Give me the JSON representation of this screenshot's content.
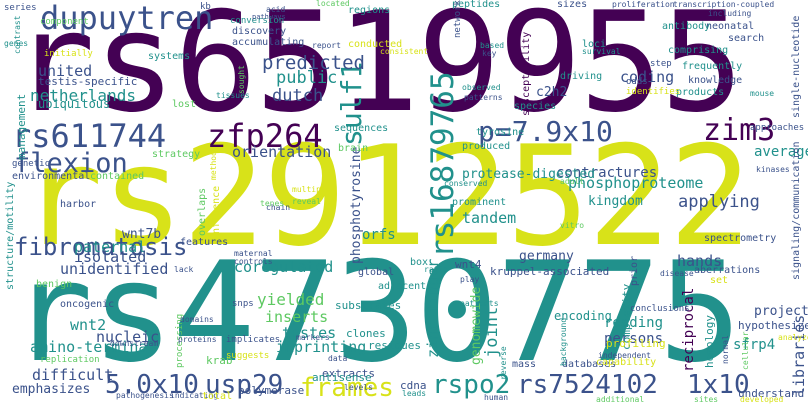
{
  "colors": {
    "background": "#ffffff",
    "purple": "#440154",
    "indigo": "#3b528b",
    "teal": "#21918c",
    "green": "#5ec962",
    "yellow": "#d8e219"
  },
  "words": [
    {
      "text": "rs6519955",
      "color": "purple"
    },
    {
      "text": "rs2912522",
      "color": "yellow"
    },
    {
      "text": "rs4730775",
      "color": "teal"
    },
    {
      "text": "dupuytren",
      "color": "indigo"
    },
    {
      "text": "rs611744",
      "color": "indigo"
    },
    {
      "text": "zfp264",
      "color": "purple"
    },
    {
      "text": "flexion",
      "color": "indigo"
    },
    {
      "text": "sulf1",
      "color": "teal"
    },
    {
      "text": "rs16879765",
      "color": "teal"
    },
    {
      "text": "p=7.9x10",
      "color": "indigo"
    },
    {
      "text": "zim3",
      "color": "purple"
    },
    {
      "text": "fibromatosis",
      "color": "indigo"
    },
    {
      "text": "5.0x10",
      "color": "indigo"
    },
    {
      "text": "usp29",
      "color": "indigo"
    },
    {
      "text": "frames",
      "color": "yellow"
    },
    {
      "text": "rspo2",
      "color": "teal"
    },
    {
      "text": "rs7524102",
      "color": "indigo"
    },
    {
      "text": "1x10",
      "color": "indigo"
    },
    {
      "text": "predicted",
      "color": "indigo"
    },
    {
      "text": "public",
      "color": "teal"
    },
    {
      "text": "dutch",
      "color": "indigo"
    },
    {
      "text": "netherlands",
      "color": "teal"
    },
    {
      "text": "united",
      "color": "indigo"
    },
    {
      "text": "testis-specific",
      "color": "indigo"
    },
    {
      "text": "ubiquitous",
      "color": "teal"
    },
    {
      "text": "orientation",
      "color": "indigo"
    },
    {
      "text": "contractures",
      "color": "indigo"
    },
    {
      "text": "protease-digested",
      "color": "teal"
    },
    {
      "text": "coding",
      "color": "indigo"
    },
    {
      "text": "c2h2",
      "color": "indigo"
    },
    {
      "text": "average",
      "color": "teal"
    },
    {
      "text": "phosphoproteome",
      "color": "teal"
    },
    {
      "text": "kingdom",
      "color": "teal"
    },
    {
      "text": "applying",
      "color": "indigo"
    },
    {
      "text": "tandem",
      "color": "teal"
    },
    {
      "text": "germany",
      "color": "indigo"
    },
    {
      "text": "kruppel-associated",
      "color": "indigo"
    },
    {
      "text": "hands",
      "color": "indigo"
    },
    {
      "text": "paternal",
      "color": "teal"
    },
    {
      "text": "isolated",
      "color": "indigo"
    },
    {
      "text": "unidentified",
      "color": "indigo"
    },
    {
      "text": "coregulated",
      "color": "teal"
    },
    {
      "text": "wnt7b",
      "color": "indigo"
    },
    {
      "text": "orfs",
      "color": "teal"
    },
    {
      "text": "wnt4",
      "color": "indigo"
    },
    {
      "text": "phosphotyrosine",
      "color": "indigo"
    },
    {
      "text": "yielded",
      "color": "green"
    },
    {
      "text": "inserts",
      "color": "green"
    },
    {
      "text": "testes",
      "color": "teal"
    },
    {
      "text": "imprinting",
      "color": "teal"
    },
    {
      "text": "zinc-finger",
      "color": "teal"
    },
    {
      "text": "genomewide",
      "color": "green"
    },
    {
      "text": "joint",
      "color": "teal"
    },
    {
      "text": "reading",
      "color": "teal"
    },
    {
      "text": "persons",
      "color": "indigo"
    },
    {
      "text": "project",
      "color": "indigo"
    },
    {
      "text": "hypothesized",
      "color": "indigo"
    },
    {
      "text": "sfrp4",
      "color": "teal"
    },
    {
      "text": "libraries",
      "color": "indigo"
    },
    {
      "text": "wnt2",
      "color": "teal"
    },
    {
      "text": "nucleic",
      "color": "indigo"
    },
    {
      "text": "amino-terminal",
      "color": "teal"
    },
    {
      "text": "difficult",
      "color": "indigo"
    },
    {
      "text": "emphasizes",
      "color": "indigo"
    },
    {
      "text": "understand",
      "color": "indigo"
    },
    {
      "text": "krab",
      "color": "green"
    },
    {
      "text": "extracts",
      "color": "indigo"
    },
    {
      "text": "clones",
      "color": "teal"
    },
    {
      "text": "residues",
      "color": "teal"
    },
    {
      "text": "cdna",
      "color": "indigo"
    },
    {
      "text": "reciprocal",
      "color": "purple"
    },
    {
      "text": "homology",
      "color": "teal"
    },
    {
      "text": "complexity",
      "color": "teal"
    },
    {
      "text": "profiling",
      "color": "yellow"
    },
    {
      "text": "encoding",
      "color": "teal"
    },
    {
      "text": "substrates",
      "color": "teal"
    },
    {
      "text": "antisense",
      "color": "teal"
    },
    {
      "text": "polymerase",
      "color": "indigo"
    },
    {
      "text": "management",
      "color": "teal"
    },
    {
      "text": "initially",
      "color": "yellow"
    },
    {
      "text": "component",
      "color": "green"
    },
    {
      "text": "series",
      "color": "indigo"
    },
    {
      "text": "contrast",
      "color": "teal"
    },
    {
      "text": "conversion",
      "color": "teal"
    },
    {
      "text": "systems",
      "color": "teal"
    },
    {
      "text": "accumulating",
      "color": "indigo"
    },
    {
      "text": "discovery",
      "color": "indigo"
    },
    {
      "text": "regions",
      "color": "teal"
    },
    {
      "text": "peptides",
      "color": "teal"
    },
    {
      "text": "sizes",
      "color": "indigo"
    },
    {
      "text": "proliferation",
      "color": "indigo"
    },
    {
      "text": "transcription-coupled",
      "color": "indigo"
    },
    {
      "text": "neonatal",
      "color": "indigo"
    },
    {
      "text": "antibody",
      "color": "teal"
    },
    {
      "text": "search",
      "color": "indigo"
    },
    {
      "text": "comprising",
      "color": "teal"
    },
    {
      "text": "frequently",
      "color": "teal"
    },
    {
      "text": "knowledge",
      "color": "indigo"
    },
    {
      "text": "products",
      "color": "teal"
    },
    {
      "text": "single-nucleotide",
      "color": "indigo"
    },
    {
      "text": "approaches",
      "color": "indigo"
    },
    {
      "text": "step",
      "color": "indigo"
    },
    {
      "text": "identifies",
      "color": "yellow"
    },
    {
      "text": "odds",
      "color": "indigo"
    },
    {
      "text": "driving",
      "color": "teal"
    },
    {
      "text": "susceptibility",
      "color": "purple"
    },
    {
      "text": "loci",
      "color": "teal"
    },
    {
      "text": "survival",
      "color": "teal"
    },
    {
      "text": "networks",
      "color": "indigo"
    },
    {
      "text": "conducted",
      "color": "yellow"
    },
    {
      "text": "report",
      "color": "indigo"
    },
    {
      "text": "kb",
      "color": "indigo"
    },
    {
      "text": "acid",
      "color": "indigo"
    },
    {
      "text": "pathways",
      "color": "indigo"
    },
    {
      "text": "including",
      "color": "indigo"
    },
    {
      "text": "lost",
      "color": "green"
    },
    {
      "text": "strategy",
      "color": "green"
    },
    {
      "text": "brain",
      "color": "green"
    },
    {
      "text": "sequences",
      "color": "teal"
    },
    {
      "text": "tyrosine",
      "color": "teal"
    },
    {
      "text": "produced",
      "color": "teal"
    },
    {
      "text": "species",
      "color": "teal"
    },
    {
      "text": "spectrometry",
      "color": "indigo"
    },
    {
      "text": "aberrations",
      "color": "indigo"
    },
    {
      "text": "kinases",
      "color": "indigo"
    },
    {
      "text": "genetic",
      "color": "indigo"
    },
    {
      "text": "environmental",
      "color": "indigo"
    },
    {
      "text": "contained",
      "color": "green"
    },
    {
      "text": "structure/motility",
      "color": "teal"
    },
    {
      "text": "signaling/communication",
      "color": "indigo"
    },
    {
      "text": "harbor",
      "color": "indigo"
    },
    {
      "text": "features",
      "color": "indigo"
    },
    {
      "text": "overlaps",
      "color": "green"
    },
    {
      "text": "influence",
      "color": "yellow"
    },
    {
      "text": "prominent",
      "color": "teal"
    },
    {
      "text": "maternal",
      "color": "indigo"
    },
    {
      "text": "controls",
      "color": "indigo"
    },
    {
      "text": "global",
      "color": "indigo"
    },
    {
      "text": "box",
      "color": "teal"
    },
    {
      "text": "adjacent",
      "color": "teal"
    },
    {
      "text": "benign",
      "color": "green"
    },
    {
      "text": "snps",
      "color": "indigo"
    },
    {
      "text": "lack",
      "color": "indigo"
    },
    {
      "text": "oncogenic",
      "color": "indigo"
    },
    {
      "text": "replication",
      "color": "green"
    },
    {
      "text": "processing",
      "color": "green"
    },
    {
      "text": "implicates",
      "color": "indigo"
    },
    {
      "text": "suggests",
      "color": "yellow"
    },
    {
      "text": "markers",
      "color": "indigo"
    },
    {
      "text": "data",
      "color": "indigo"
    },
    {
      "text": "pathogenesis",
      "color": "indigo"
    },
    {
      "text": "indicating",
      "color": "indigo"
    },
    {
      "text": "total",
      "color": "yellow"
    },
    {
      "text": "human",
      "color": "indigo"
    },
    {
      "text": "mass",
      "color": "indigo"
    },
    {
      "text": "databases",
      "color": "indigo"
    },
    {
      "text": "independent",
      "color": "indigo"
    },
    {
      "text": "capability",
      "color": "yellow"
    },
    {
      "text": "conclusions",
      "color": "indigo"
    },
    {
      "text": "patients",
      "color": "teal"
    },
    {
      "text": "ratio",
      "color": "teal"
    },
    {
      "text": "disease",
      "color": "indigo"
    },
    {
      "text": "set",
      "color": "yellow"
    },
    {
      "text": "prior",
      "color": "indigo"
    },
    {
      "text": "play",
      "color": "indigo"
    },
    {
      "text": "conserved",
      "color": "teal"
    },
    {
      "text": "multiple",
      "color": "yellow"
    },
    {
      "text": "reveal",
      "color": "green"
    },
    {
      "text": "method",
      "color": "yellow"
    },
    {
      "text": "sought",
      "color": "green"
    },
    {
      "text": "tissues",
      "color": "teal"
    },
    {
      "text": "observed",
      "color": "teal"
    },
    {
      "text": "patterns",
      "color": "indigo"
    },
    {
      "text": "based",
      "color": "teal"
    },
    {
      "text": "key",
      "color": "indigo"
    },
    {
      "text": "located",
      "color": "green"
    },
    {
      "text": "developed",
      "color": "yellow"
    },
    {
      "text": "additional",
      "color": "green"
    },
    {
      "text": "sites",
      "color": "green"
    },
    {
      "text": "leads",
      "color": "teal"
    },
    {
      "text": "levels",
      "color": "indigo"
    },
    {
      "text": "domains",
      "color": "indigo"
    },
    {
      "text": "proteins",
      "color": "indigo"
    },
    {
      "text": "downstream",
      "color": "indigo"
    },
    {
      "text": "chain",
      "color": "indigo"
    },
    {
      "text": "vitro",
      "color": "green"
    },
    {
      "text": "adult",
      "color": "green"
    },
    {
      "text": "reverse",
      "color": "teal"
    },
    {
      "text": "background",
      "color": "teal"
    },
    {
      "text": "cellular",
      "color": "green"
    },
    {
      "text": "normal",
      "color": "indigo"
    },
    {
      "text": "mouse",
      "color": "teal"
    },
    {
      "text": "analyzed",
      "color": "yellow"
    },
    {
      "text": "tenes",
      "color": "green"
    },
    {
      "text": "consistent",
      "color": "yellow"
    },
    {
      "text": "genes",
      "color": "teal"
    }
  ]
}
